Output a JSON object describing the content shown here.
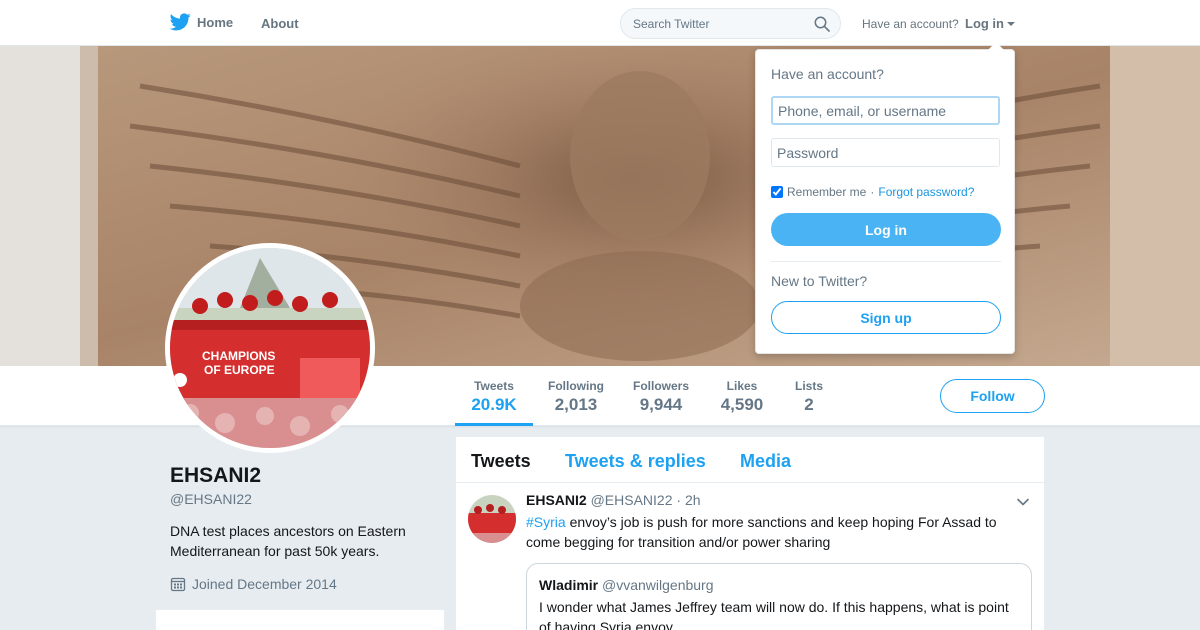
{
  "nav": {
    "home_label": "Home",
    "about_label": "About",
    "search_placeholder": "Search Twitter",
    "have_account_text": "Have an account?",
    "login_label": "Log in"
  },
  "profile": {
    "name": "EHSANI2",
    "handle": "@EHSANI22",
    "bio": "DNA test places ancestors on Eastern Mediterranean for past 50k years.",
    "joined": "Joined December 2014",
    "avatar_text": [
      "CHAMPIONS",
      "OF EUROPE"
    ]
  },
  "stats": [
    {
      "label": "Tweets",
      "value": "20.9K",
      "active": true
    },
    {
      "label": "Following",
      "value": "2,013"
    },
    {
      "label": "Followers",
      "value": "9,944"
    },
    {
      "label": "Likes",
      "value": "4,590"
    },
    {
      "label": "Lists",
      "value": "2"
    }
  ],
  "follow_label": "Follow",
  "timeline": {
    "tabs": [
      "Tweets",
      "Tweets & replies",
      "Media"
    ],
    "active_tab": "Tweets",
    "tweet": {
      "name": "EHSANI2",
      "handle": "@EHSANI22",
      "separator": "·",
      "time": "2h",
      "hashtag": "#Syria",
      "text": " envoy’s job is push for more sanctions and keep hoping For Assad to come begging for transition and/or power sharing",
      "quote": {
        "name": "Wladimir",
        "handle": "@vvanwilgenburg",
        "text": "I wonder what James Jeffrey team will now do. If this happens, what is point of having Syria envoy."
      }
    }
  },
  "login_dropdown": {
    "title": "Have an account?",
    "username_placeholder": "Phone, email, or username",
    "password_placeholder": "Password",
    "remember_label": "Remember me",
    "separator": "·",
    "forgot_label": "Forgot password?",
    "login_button": "Log in",
    "new_text": "New to Twitter?",
    "signup_button": "Sign up"
  },
  "colors": {
    "brand_blue": "#1da1f2",
    "login_button": "#4ab3f4",
    "background": "#e6ecf0"
  },
  "icons": [
    "twitter-bird-icon",
    "search-icon",
    "caret-down-icon",
    "calendar-icon",
    "chevron-down-icon"
  ]
}
